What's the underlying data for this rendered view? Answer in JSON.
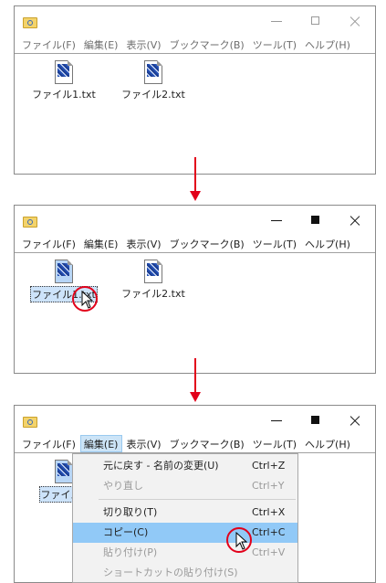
{
  "menu": [
    "ファイル(F)",
    "編集(E)",
    "表示(V)",
    "ブックマーク(B)",
    "ツール(T)",
    "ヘルプ(H)"
  ],
  "files": {
    "file1": "ファイル1.txt",
    "file2": "ファイル2.txt",
    "file1_truncated": "ファイル1"
  },
  "edit_menu": {
    "undo": {
      "label": "元に戻す - 名前の変更(U)",
      "shortcut": "Ctrl+Z"
    },
    "redo": {
      "label": "やり直し",
      "shortcut": "Ctrl+Y"
    },
    "cut": {
      "label": "切り取り(T)",
      "shortcut": "Ctrl+X"
    },
    "copy": {
      "label": "コピー(C)",
      "shortcut": "Ctrl+C"
    },
    "paste": {
      "label": "貼り付け(P)",
      "shortcut": "Ctrl+V"
    },
    "paste_shortcut": {
      "label": "ショートカットの貼り付け(S)"
    }
  },
  "colors": {
    "accent_red": "#e2001a",
    "highlight": "#91c9f7",
    "menu_active": "#cce4f7"
  }
}
